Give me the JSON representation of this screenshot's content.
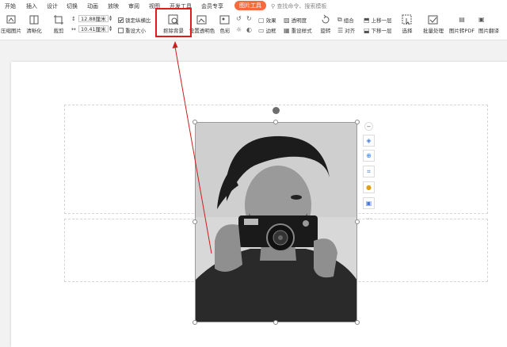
{
  "menu": {
    "tabs": [
      "开始",
      "插入",
      "设计",
      "切换",
      "动画",
      "放映",
      "审阅",
      "视图",
      "开发工具",
      "会员专享",
      "图片工具"
    ],
    "active_tab": "图片工具",
    "search": "查找命令、搜索模板"
  },
  "ribbon": {
    "compress": "压缩图片",
    "sharpen": "清晰化",
    "crop": "裁剪",
    "height_value": "12.88厘米",
    "width_value": "10.41厘米",
    "lock_ratio": "锁定纵横比",
    "reset_size": "重设大小",
    "remove_bg": "抠除背景",
    "set_transparent": "设置透明色",
    "color": "色彩",
    "effects": "效果",
    "transparency": "透明度",
    "border": "边框",
    "reset_style": "重设样式",
    "rotate": "旋转",
    "group": "组合",
    "align": "对齐",
    "bring_forward": "上移一层",
    "send_backward": "下移一层",
    "select": "选择",
    "batch": "批量处理",
    "to_pdf": "图片转PDF",
    "translate": "图片翻译"
  },
  "accent_color": "#f36b3f",
  "highlight_color": "#e01b1b"
}
